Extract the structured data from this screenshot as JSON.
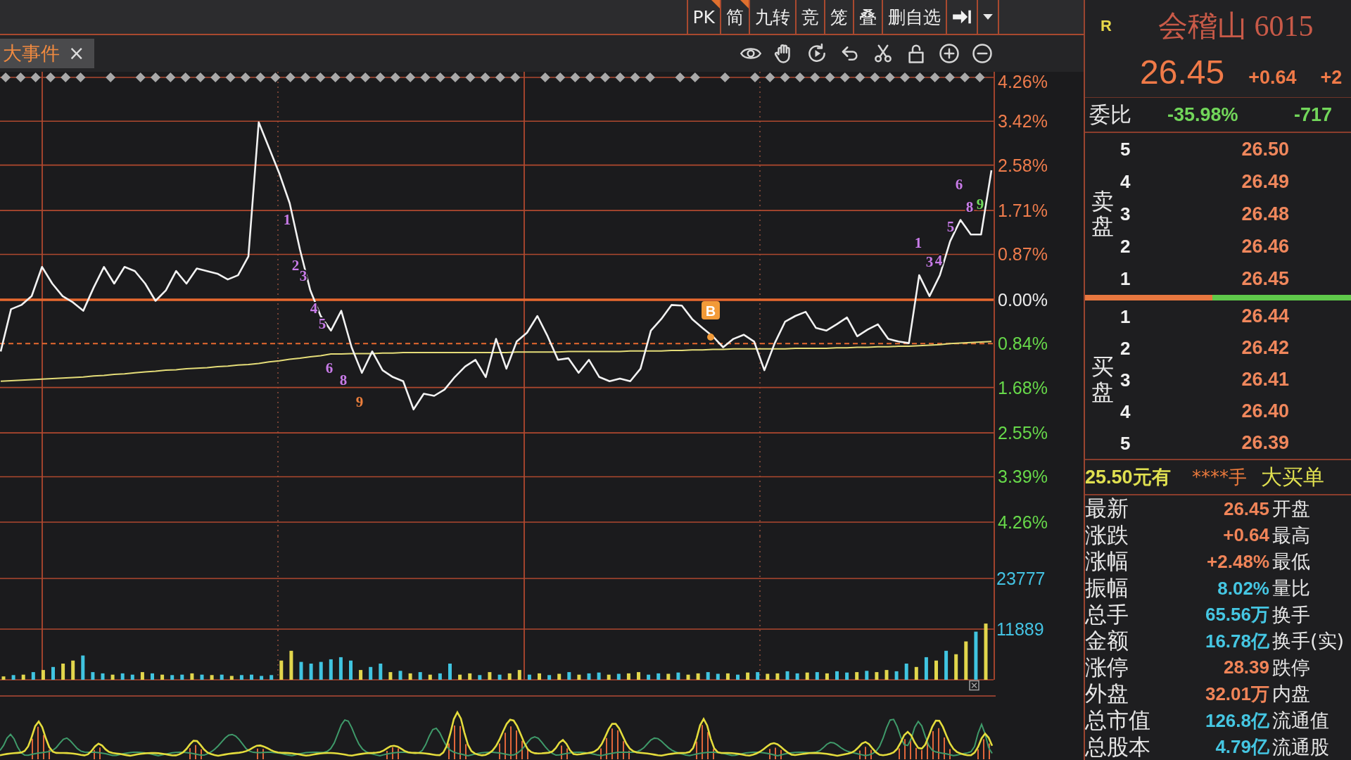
{
  "toolbar": {
    "buttons": [
      {
        "label": "PK",
        "flagged": true
      },
      {
        "label": "简",
        "flagged": true
      },
      {
        "label": "九转",
        "flagged": false
      },
      {
        "label": "竞",
        "flagged": false
      },
      {
        "label": "笼",
        "flagged": false
      },
      {
        "label": "叠",
        "flagged": false
      },
      {
        "label": "删自选",
        "flagged": false
      }
    ]
  },
  "tab": {
    "label": "大事件",
    "close": "×"
  },
  "chart": {
    "chart_data": [
      {
        "type": "line",
        "categories": [
          null,
          null,
          null,
          null,
          null,
          null,
          null,
          null,
          null,
          null,
          null,
          null,
          null,
          null,
          null,
          null,
          null,
          null,
          null,
          null,
          null,
          null,
          null,
          null,
          null,
          null,
          null,
          null,
          null,
          null,
          null,
          null,
          null,
          null,
          null,
          null,
          null,
          null,
          null,
          null,
          null,
          null,
          null,
          null,
          null,
          null,
          null,
          null,
          null,
          null,
          null,
          null,
          null,
          null,
          null,
          null,
          null,
          null,
          null,
          null,
          null,
          null,
          null,
          null,
          null,
          null,
          null,
          null,
          null,
          null,
          null,
          null,
          null,
          null,
          null,
          null,
          null,
          null,
          null,
          null,
          null,
          null,
          null,
          null,
          null,
          null,
          null,
          null,
          null,
          null,
          null,
          null,
          null,
          null,
          null,
          null,
          null
        ],
        "series": [
          {
            "color": "#f2f2f2",
            "values": [
              -0.99,
              -0.18,
              -0.1,
              0.07,
              0.63,
              0.31,
              0.07,
              -0.05,
              -0.21,
              0.23,
              0.63,
              0.31,
              0.63,
              0.55,
              0.31,
              -0.02,
              0.18,
              0.55,
              0.31,
              0.6,
              0.55,
              0.5,
              0.39,
              0.47,
              0.83,
              3.4,
              2.91,
              2.42,
              1.85,
              0.96,
              0.18,
              -0.31,
              -0.59,
              -0.21,
              -0.91,
              -1.4,
              -0.99,
              -1.35,
              -1.48,
              -1.56,
              -2.1,
              -1.8,
              -1.84,
              -1.72,
              -1.48,
              -1.28,
              -1.15,
              -1.48,
              -0.75,
              -1.32,
              -0.8,
              -0.63,
              -0.31,
              -0.7,
              -1.15,
              -1.12,
              -1.4,
              -1.15,
              -1.48,
              -1.56,
              -1.51,
              -1.56,
              -1.32,
              -0.59,
              -0.37,
              -0.1,
              -0.11,
              -0.37,
              -0.54,
              -0.7,
              -0.91,
              -0.75,
              -0.67,
              -0.8,
              -1.35,
              -0.83,
              -0.42,
              -0.31,
              -0.23,
              -0.54,
              -0.59,
              -0.47,
              -0.34,
              -0.7,
              -0.57,
              -0.47,
              -0.75,
              -0.8,
              -0.83,
              0.47,
              0.07,
              0.47,
              1.12,
              1.53,
              1.25,
              1.25,
              2.48
            ]
          },
          {
            "color": "#e4dc78",
            "values": [
              -1.56,
              -1.55,
              -1.54,
              -1.53,
              -1.52,
              -1.51,
              -1.5,
              -1.49,
              -1.48,
              -1.46,
              -1.45,
              -1.43,
              -1.42,
              -1.4,
              -1.38,
              -1.37,
              -1.35,
              -1.34,
              -1.32,
              -1.31,
              -1.3,
              -1.28,
              -1.27,
              -1.25,
              -1.24,
              -1.22,
              -1.19,
              -1.17,
              -1.14,
              -1.12,
              -1.09,
              -1.07,
              -1.04,
              -1.04,
              -1.03,
              -1.03,
              -1.03,
              -1.02,
              -1.02,
              -1.01,
              -1.01,
              -1.01,
              -1.01,
              -1.01,
              -1.01,
              -1.01,
              -1.01,
              -1.01,
              -1.01,
              -1.01,
              -1.0,
              -1.0,
              -1.0,
              -1.0,
              -1.0,
              -0.99,
              -0.99,
              -0.99,
              -0.99,
              -0.99,
              -0.99,
              -0.98,
              -0.98,
              -0.98,
              -0.98,
              -0.97,
              -0.97,
              -0.96,
              -0.96,
              -0.95,
              -0.95,
              -0.94,
              -0.94,
              -0.94,
              -0.94,
              -0.94,
              -0.94,
              -0.93,
              -0.93,
              -0.93,
              -0.93,
              -0.92,
              -0.92,
              -0.91,
              -0.91,
              -0.9,
              -0.9,
              -0.89,
              -0.89,
              -0.88,
              -0.87,
              -0.86,
              -0.84,
              -0.83,
              -0.82,
              -0.81,
              -0.8
            ]
          }
        ],
        "ylim": [
          -4.26,
          4.26
        ],
        "yticks": [
          {
            "value": 4.26,
            "label": "4.26%"
          },
          {
            "value": 3.42,
            "label": "3.42%"
          },
          {
            "value": 2.58,
            "label": "2.58%"
          },
          {
            "value": 1.71,
            "label": "1.71%"
          },
          {
            "value": 0.87,
            "label": "0.87%"
          },
          {
            "value": 0,
            "label": "0.00%"
          },
          {
            "value": -0.84,
            "label": "0.84%"
          },
          {
            "value": -1.68,
            "label": "1.68%"
          },
          {
            "value": -2.55,
            "label": "2.55%"
          },
          {
            "value": -3.39,
            "label": "3.39%"
          },
          {
            "value": -4.26,
            "label": "4.26%"
          }
        ],
        "grid": true,
        "ref_lines": [
          {
            "axis": "y",
            "value": 0,
            "color": "#e8692f",
            "line_style": "solid"
          },
          {
            "axis": "y",
            "value": -0.84,
            "color": "#e8692f",
            "line_style": "dashed"
          }
        ]
      },
      {
        "type": "bar",
        "categories": [
          null,
          null,
          null,
          null,
          null,
          null,
          null,
          null,
          null,
          null,
          null,
          null,
          null,
          null,
          null,
          null,
          null,
          null,
          null,
          null,
          null,
          null,
          null,
          null,
          null,
          null,
          null,
          null,
          null,
          null,
          null,
          null,
          null,
          null,
          null,
          null,
          null,
          null,
          null,
          null,
          null,
          null,
          null,
          null,
          null,
          null,
          null,
          null,
          null,
          null,
          null,
          null,
          null,
          null,
          null,
          null,
          null,
          null,
          null,
          null,
          null,
          null,
          null,
          null,
          null,
          null,
          null,
          null,
          null,
          null,
          null,
          null,
          null,
          null,
          null,
          null,
          null,
          null,
          null,
          null,
          null,
          null,
          null,
          null,
          null,
          null,
          null,
          null,
          null,
          null,
          null,
          null,
          null,
          null,
          null,
          null,
          null,
          null,
          null,
          null
        ],
        "values": [
          800,
          1100,
          1200,
          1800,
          2300,
          3000,
          3800,
          4500,
          5700,
          1800,
          1500,
          1200,
          1500,
          1200,
          1800,
          1500,
          1200,
          1100,
          1200,
          1500,
          1200,
          1100,
          1200,
          900,
          1100,
          1200,
          900,
          1100,
          4500,
          6800,
          4200,
          3800,
          4200,
          4800,
          5300,
          4500,
          2300,
          3000,
          3800,
          1800,
          2100,
          1500,
          1800,
          1200,
          1500,
          3800,
          1200,
          1500,
          1100,
          1800,
          1200,
          1500,
          2300,
          1200,
          1500,
          1100,
          1400,
          1800,
          1200,
          1500,
          1700,
          1200,
          1400,
          1500,
          1800,
          1200,
          1500,
          1400,
          1700,
          1200,
          1500,
          1800,
          1400,
          1500,
          1200,
          1700,
          1800,
          1400,
          1500,
          2000,
          1500,
          1700,
          1800,
          1500,
          2000,
          1700,
          1800,
          2100,
          1800,
          2300,
          2000,
          3800,
          3000,
          5300,
          4500,
          6800,
          6000,
          9000,
          11300,
          13200
        ],
        "colors": [
          "#e2d64c",
          "#40c4e0",
          "#e2d64c",
          "#40c4e0",
          "#e2d64c",
          "#40c4e0",
          "#e2d64c",
          "#e2d64c",
          "#40c4e0",
          "#40c4e0",
          "#40c4e0",
          "#e2d64c",
          "#40c4e0",
          "#40c4e0",
          "#e2d64c",
          "#40c4e0",
          "#e2d64c",
          "#40c4e0",
          "#40c4e0",
          "#e2d64c",
          "#40c4e0",
          "#e2d64c",
          "#40c4e0",
          "#e2d64c",
          "#40c4e0",
          "#40c4e0",
          "#40c4e0",
          "#40c4e0",
          "#e2d64c",
          "#e2d64c",
          "#40c4e0",
          "#40c4e0",
          "#40c4e0",
          "#40c4e0",
          "#40c4e0",
          "#40c4e0",
          "#e2d64c",
          "#40c4e0",
          "#40c4e0",
          "#e2d64c",
          "#40c4e0",
          "#e2d64c",
          "#40c4e0",
          "#e2d64c",
          "#40c4e0",
          "#40c4e0",
          "#e2d64c",
          "#e2d64c",
          "#40c4e0",
          "#e2d64c",
          "#40c4e0",
          "#e2d64c",
          "#e2d64c",
          "#40c4e0",
          "#e2d64c",
          "#40c4e0",
          "#e2d64c",
          "#40c4e0",
          "#e2d64c",
          "#40c4e0",
          "#40c4e0",
          "#e2d64c",
          "#40c4e0",
          "#e2d64c",
          "#e2d64c",
          "#40c4e0",
          "#40c4e0",
          "#e2d64c",
          "#40c4e0",
          "#e2d64c",
          "#e2d64c",
          "#40c4e0",
          "#40c4e0",
          "#e2d64c",
          "#40c4e0",
          "#e2d64c",
          "#40c4e0",
          "#e2d64c",
          "#e2d64c",
          "#40c4e0",
          "#40c4e0",
          "#e2d64c",
          "#40c4e0",
          "#e2d64c",
          "#40c4e0",
          "#40c4e0",
          "#e2d64c",
          "#40c4e0",
          "#e2d64c",
          "#e2d64c",
          "#40c4e0",
          "#40c4e0",
          "#e2d64c",
          "#40c4e0",
          "#e2d64c",
          "#40c4e0",
          "#e2d64c",
          "#e2d64c",
          "#40c4e0",
          "#e2d64c"
        ],
        "ylim": [
          0,
          23777
        ],
        "yticks": [
          11889,
          23777
        ],
        "grid": true,
        "ref_lines": [
          {
            "axis": "y",
            "value": 11889,
            "color": "#b0492f",
            "line_style": "solid"
          }
        ]
      }
    ],
    "sequence_marks": [
      {
        "label": "1",
        "color": "#c87be8"
      },
      {
        "label": "2",
        "color": "#c87be8"
      },
      {
        "label": "3",
        "color": "#c87be8"
      },
      {
        "label": "4",
        "color": "#c87be8"
      },
      {
        "label": "5",
        "color": "#c87be8"
      },
      {
        "label": "6",
        "color": "#c87be8"
      },
      {
        "label": "8",
        "color": "#c87be8"
      },
      {
        "label": "9",
        "color": "#ec7f3c"
      },
      {
        "label": "1",
        "color": "#c87be8"
      },
      {
        "label": "3",
        "color": "#c87be8"
      },
      {
        "label": "4",
        "color": "#c87be8"
      },
      {
        "label": "5",
        "color": "#c87be8"
      },
      {
        "label": "6",
        "color": "#c87be8"
      },
      {
        "label": "8",
        "color": "#c87be8"
      },
      {
        "label": "9",
        "color": "#6fd85a"
      }
    ],
    "trade_marker": {
      "label": "B"
    }
  },
  "quote": {
    "flag": "R",
    "name": "会稽山 6015",
    "price": "26.45",
    "change": "+0.64",
    "change_pct": "+2"
  },
  "order_ratio": {
    "label": "委比",
    "percent": "-35.98%",
    "difference": "-717"
  },
  "order_book": {
    "asks_label": "卖盘",
    "asks": [
      {
        "rank": "5",
        "price": "26.50"
      },
      {
        "rank": "4",
        "price": "26.49"
      },
      {
        "rank": "3",
        "price": "26.48"
      },
      {
        "rank": "2",
        "price": "26.46"
      },
      {
        "rank": "1",
        "price": "26.45"
      }
    ],
    "strength": {
      "level": 0.48
    },
    "bids_label": "买盘",
    "bids": [
      {
        "rank": "1",
        "price": "26.44"
      },
      {
        "rank": "2",
        "price": "26.42"
      },
      {
        "rank": "3",
        "price": "26.41"
      },
      {
        "rank": "4",
        "price": "26.40"
      },
      {
        "rank": "5",
        "price": "26.39"
      }
    ]
  },
  "big_order": {
    "price_text": "25.50元有",
    "volume_text": "****手",
    "label": "大买单"
  },
  "stats": [
    {
      "label": "最新",
      "value": "26.45",
      "color": "#f08458",
      "label_2": "开盘"
    },
    {
      "label": "涨跌",
      "value": "+0.64",
      "color": "#f08458",
      "label_2": "最高"
    },
    {
      "label": "涨幅",
      "value": "+2.48%",
      "color": "#f08458",
      "label_2": "最低"
    },
    {
      "label": "振幅",
      "value": "8.02%",
      "color": "#45c6e2",
      "label_2": "量比"
    },
    {
      "label": "总手",
      "value": "65.56万",
      "color": "#45c6e2",
      "label_2": "换手"
    },
    {
      "label": "金额",
      "value": "16.78亿",
      "color": "#45c6e2",
      "label_2": "换手(实)"
    },
    {
      "label": "涨停",
      "value": "28.39",
      "color": "#f08458",
      "label_2": "跌停"
    },
    {
      "label": "外盘",
      "value": "32.01万",
      "color": "#f08458",
      "label_2": "内盘"
    },
    {
      "label": "总市值",
      "value": "126.8亿",
      "color": "#45c6e2",
      "label_2": "流通值"
    },
    {
      "label": "总股本",
      "value": "4.79亿",
      "color": "#45c6e2",
      "label_2": "流通股"
    }
  ]
}
